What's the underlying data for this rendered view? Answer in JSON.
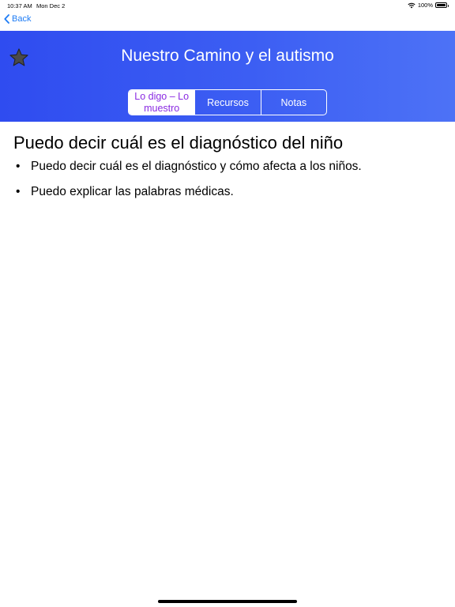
{
  "status_bar": {
    "time": "10:37 AM",
    "date": "Mon Dec 2",
    "battery": "100%",
    "wifi_icon": "wifi-icon",
    "battery_icon": "battery-icon"
  },
  "nav": {
    "back_label": "Back",
    "back_icon": "chevron-left-icon"
  },
  "header": {
    "title": "Nuestro Camino y el autismo",
    "star_icon": "star-icon",
    "background_color": "#3b5cf2"
  },
  "tabs": [
    {
      "label": "Lo digo – Lo muestro",
      "selected": true
    },
    {
      "label": "Recursos",
      "selected": false
    },
    {
      "label": "Notas",
      "selected": false
    }
  ],
  "selected_tab_color": "#8a2be2",
  "content": {
    "heading": "Puedo decir cuál es el diagnóstico del niño",
    "bullet_symbol": "•",
    "items": [
      "Puedo decir cuál es el diagnóstico y cómo afecta a los niños.",
      "Puedo explicar las palabras médicas."
    ]
  }
}
